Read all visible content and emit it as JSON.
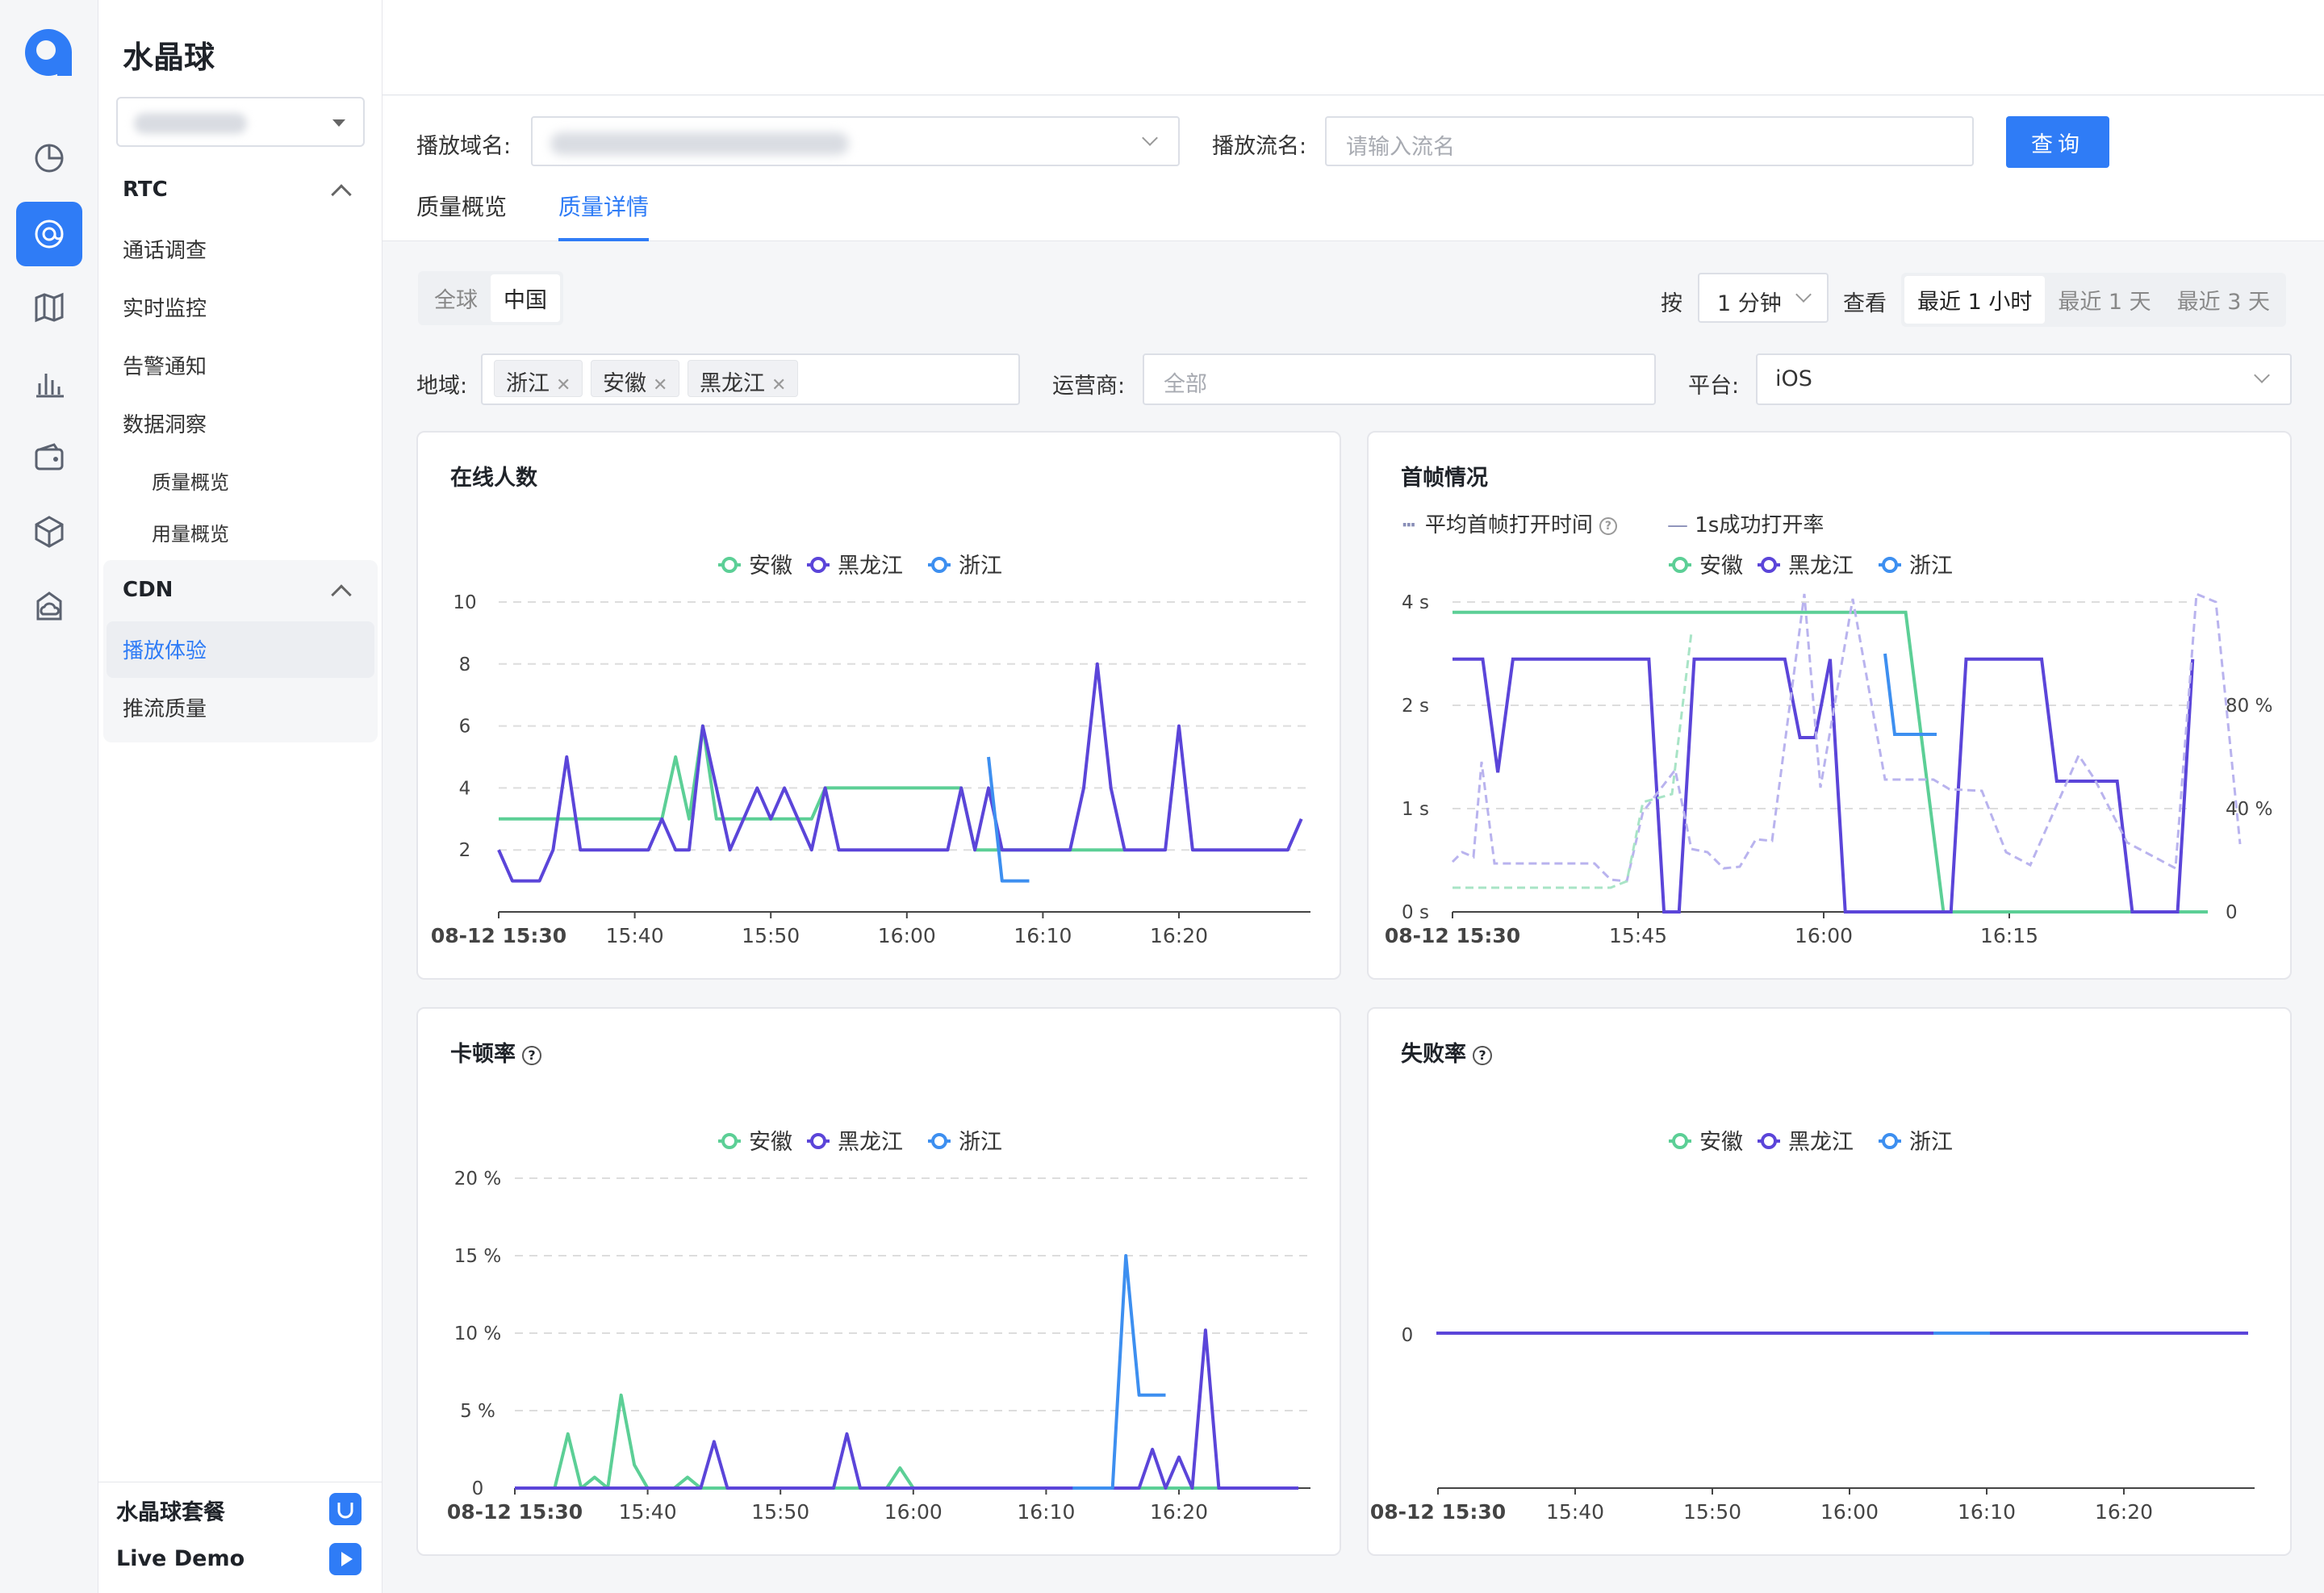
{
  "app": {
    "title": "水晶球"
  },
  "sidebar": {
    "rtc_label": "RTC",
    "rtc_items": [
      "通话调查",
      "实时监控",
      "告警通知",
      "数据洞察"
    ],
    "insight_sub": [
      "质量概览",
      "用量概览"
    ],
    "cdn_label": "CDN",
    "cdn_items": [
      "播放体验",
      "推流质量"
    ],
    "bottom": [
      {
        "label": "水晶球套餐",
        "icon": "bag-icon"
      },
      {
        "label": "Live Demo",
        "icon": "play-icon"
      }
    ]
  },
  "rail_icons": [
    "pie-chart-icon",
    "at-sign-icon",
    "map-icon",
    "bar-chart-icon",
    "wallet-icon",
    "cube-icon",
    "cloud-box-icon"
  ],
  "filter": {
    "domain_label": "播放域名:",
    "stream_label": "播放流名:",
    "stream_placeholder": "请输入流名",
    "query_button": "查询",
    "tabs": [
      "质量概览",
      "质量详情"
    ],
    "active_tab": "质量详情"
  },
  "controls": {
    "scope": [
      "全球",
      "中国"
    ],
    "scope_selected": "中国",
    "by_label": "按",
    "interval": "1 分钟",
    "view_label": "查看",
    "ranges": [
      "最近 1 小时",
      "最近 1 天",
      "最近 3 天"
    ],
    "range_selected": "最近 1 小时",
    "region_label": "地域:",
    "regions": [
      "浙江",
      "安徽",
      "黑龙江"
    ],
    "isp_label": "运营商:",
    "isp_placeholder": "全部",
    "platform_label": "平台:",
    "platform_value": "iOS"
  },
  "colors": {
    "anhui": "#5ccf96",
    "heilongjiang": "#5b45d9",
    "zhejiang": "#3d8ff0",
    "accent": "#2f7cf6"
  },
  "legend": [
    "安徽",
    "黑龙江",
    "浙江"
  ],
  "chart_data": [
    {
      "type": "line",
      "title": "在线人数",
      "x": [
        "15:30",
        "15:31",
        "15:32",
        "15:33",
        "15:34",
        "15:35",
        "15:36",
        "15:37",
        "15:38",
        "15:39",
        "15:40",
        "15:41",
        "15:42",
        "15:43",
        "15:44",
        "15:45",
        "15:46",
        "15:47",
        "15:48",
        "15:49",
        "15:50",
        "15:51",
        "15:52",
        "15:53",
        "15:54",
        "15:55",
        "15:56",
        "15:57",
        "15:58",
        "15:59",
        "16:00",
        "16:01",
        "16:02",
        "16:03",
        "16:04",
        "16:05",
        "16:06",
        "16:07",
        "16:08",
        "16:09",
        "16:10",
        "16:11",
        "16:12",
        "16:13",
        "16:14",
        "16:15",
        "16:16",
        "16:17",
        "16:18",
        "16:19",
        "16:20",
        "16:21",
        "16:22",
        "16:23",
        "16:24",
        "16:25",
        "16:26",
        "16:27",
        "16:28",
        "16:29"
      ],
      "x_ticks": [
        "08-12 15:30",
        "15:40",
        "15:50",
        "16:00",
        "16:10",
        "16:20"
      ],
      "ylim": [
        0,
        10
      ],
      "y_ticks": [
        "2",
        "4",
        "6",
        "8",
        "10"
      ],
      "series": [
        {
          "name": "安徽",
          "values": [
            3,
            3,
            3,
            3,
            3,
            3,
            3,
            3,
            3,
            3,
            3,
            3,
            3,
            5,
            3,
            6,
            3,
            3,
            3,
            3,
            3,
            3,
            3,
            3,
            4,
            4,
            4,
            4,
            4,
            4,
            4,
            4,
            4,
            4,
            4,
            2,
            2,
            2,
            2,
            2,
            2,
            2,
            2,
            2,
            2,
            2,
            2
          ]
        },
        {
          "name": "黑龙江",
          "values": [
            2,
            1,
            1,
            1,
            2,
            5,
            2,
            2,
            2,
            2,
            2,
            2,
            3,
            2,
            2,
            6,
            4,
            2,
            3,
            4,
            3,
            4,
            3,
            2,
            4,
            2,
            2,
            2,
            2,
            2,
            2,
            2,
            2,
            2,
            4,
            2,
            4,
            2,
            2,
            2,
            2,
            2,
            2,
            4,
            8,
            4,
            2,
            2,
            2,
            2,
            6,
            2,
            2,
            2,
            2,
            2,
            2,
            2,
            2,
            3
          ]
        },
        {
          "name": "浙江",
          "values": [
            null,
            null,
            null,
            null,
            null,
            null,
            null,
            null,
            null,
            null,
            null,
            null,
            null,
            null,
            null,
            null,
            null,
            null,
            null,
            null,
            null,
            null,
            null,
            null,
            null,
            null,
            null,
            null,
            null,
            null,
            null,
            null,
            null,
            null,
            null,
            null,
            5,
            1,
            1,
            1
          ]
        }
      ]
    },
    {
      "type": "line",
      "title": "首帧情况",
      "sub_legend": [
        "平均首帧打开时间",
        "1s成功打开率"
      ],
      "x_ticks": [
        "08-12 15:30",
        "15:45",
        "16:00",
        "16:15"
      ],
      "y_left_ticks": [
        "0 s",
        "1 s",
        "2 s",
        "4 s"
      ],
      "y_right_ticks": [
        "0",
        "40 %",
        "80 %"
      ]
    },
    {
      "type": "line",
      "title": "卡顿率",
      "x_ticks": [
        "08-12 15:30",
        "15:40",
        "15:50",
        "16:00",
        "16:10",
        "16:20"
      ],
      "ylim": [
        0,
        20
      ],
      "y_ticks": [
        "0",
        "5 %",
        "10 %",
        "15 %",
        "20 %"
      ],
      "series": [
        {
          "name": "安徽",
          "values": [
            0,
            0,
            0,
            0,
            3.5,
            0,
            0.7,
            0,
            6,
            1.5,
            0,
            0,
            0,
            0.7,
            0,
            0,
            0,
            0,
            0,
            0,
            0,
            0,
            0,
            0,
            0,
            0,
            0,
            0,
            0,
            1.3,
            0,
            0,
            0,
            0,
            0,
            0,
            0,
            0,
            0,
            0,
            0,
            0,
            0,
            0,
            0,
            0,
            0,
            0,
            0,
            0,
            0,
            0,
            0,
            0,
            0,
            0,
            0,
            0,
            0,
            0
          ]
        },
        {
          "name": "黑龙江",
          "values": [
            0,
            0,
            0,
            0,
            0,
            0,
            0,
            0,
            0,
            0,
            0,
            0,
            0,
            0,
            0,
            3,
            0,
            0,
            0,
            0,
            0,
            0,
            0,
            0,
            0,
            3.5,
            0,
            0,
            0,
            0,
            0,
            0,
            0,
            0,
            0,
            0,
            0,
            0,
            0,
            0,
            0,
            0,
            0,
            0,
            0,
            0,
            0,
            0,
            2.5,
            0,
            2,
            0,
            10.2,
            0,
            0,
            0,
            0,
            0,
            0,
            0
          ]
        },
        {
          "name": "浙江",
          "values": [
            null,
            null,
            null,
            null,
            null,
            null,
            null,
            null,
            null,
            null,
            null,
            null,
            null,
            null,
            null,
            null,
            null,
            null,
            null,
            null,
            null,
            null,
            null,
            null,
            null,
            null,
            null,
            null,
            null,
            null,
            null,
            null,
            null,
            null,
            null,
            null,
            null,
            null,
            null,
            null,
            null,
            null,
            0,
            0,
            0,
            0,
            15,
            6,
            6,
            6
          ]
        }
      ]
    },
    {
      "type": "line",
      "title": "失败率",
      "x_ticks": [
        "08-12 15:30",
        "15:40",
        "15:50",
        "16:00",
        "16:10",
        "16:20"
      ],
      "y_ticks": [
        "0"
      ],
      "series": [
        {
          "name": "安徽",
          "values": [
            0
          ]
        },
        {
          "name": "黑龙江",
          "values": [
            0
          ]
        },
        {
          "name": "浙江",
          "values": [
            0
          ]
        }
      ]
    }
  ]
}
